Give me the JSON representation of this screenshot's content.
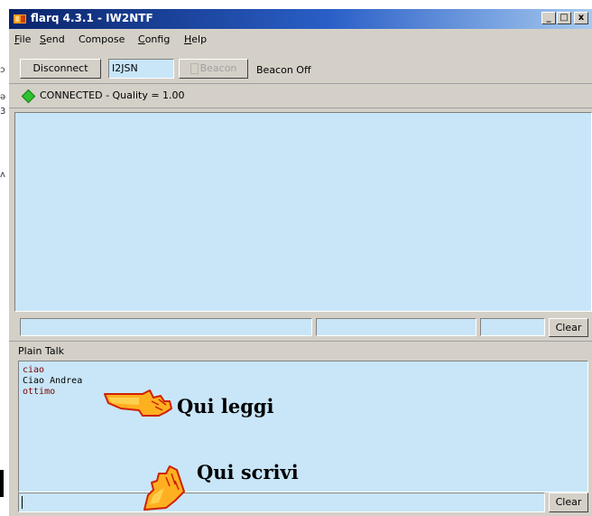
{
  "window": {
    "title": "flarq 4.3.1 - IW2NTF",
    "min_label": "_",
    "max_label": "□",
    "close_label": "x"
  },
  "menu": [
    {
      "label": "File",
      "accel": "F",
      "rest": "ile"
    },
    {
      "label": "Send",
      "accel": "S",
      "rest": "end"
    },
    {
      "label": "Compose",
      "accel": "",
      "rest": "Compose"
    },
    {
      "label": "Config",
      "accel": "C",
      "rest": "onfig"
    },
    {
      "label": "Help",
      "accel": "H",
      "rest": "elp"
    }
  ],
  "toolbar": {
    "disconnect_label": "Disconnect",
    "callsign_value": "I2JSN",
    "beacon_label": "Beacon",
    "beacon_status": "Beacon Off"
  },
  "status": {
    "text": "CONNECTED - Quality = 1.00",
    "indicator_color": "#2fc12f"
  },
  "transfer": {
    "clear_label": "Clear"
  },
  "plain_talk": {
    "section_label": "Plain Talk",
    "messages": [
      {
        "text": "ciao",
        "color": "#800000"
      },
      {
        "text": "Ciao Andrea",
        "color": "#000000"
      },
      {
        "text": "ottimo",
        "color": "#800000"
      }
    ],
    "input_value": "",
    "clear_label": "Clear"
  },
  "annotations": {
    "read_label": "Qui leggi",
    "write_label": "Qui scrivi"
  }
}
